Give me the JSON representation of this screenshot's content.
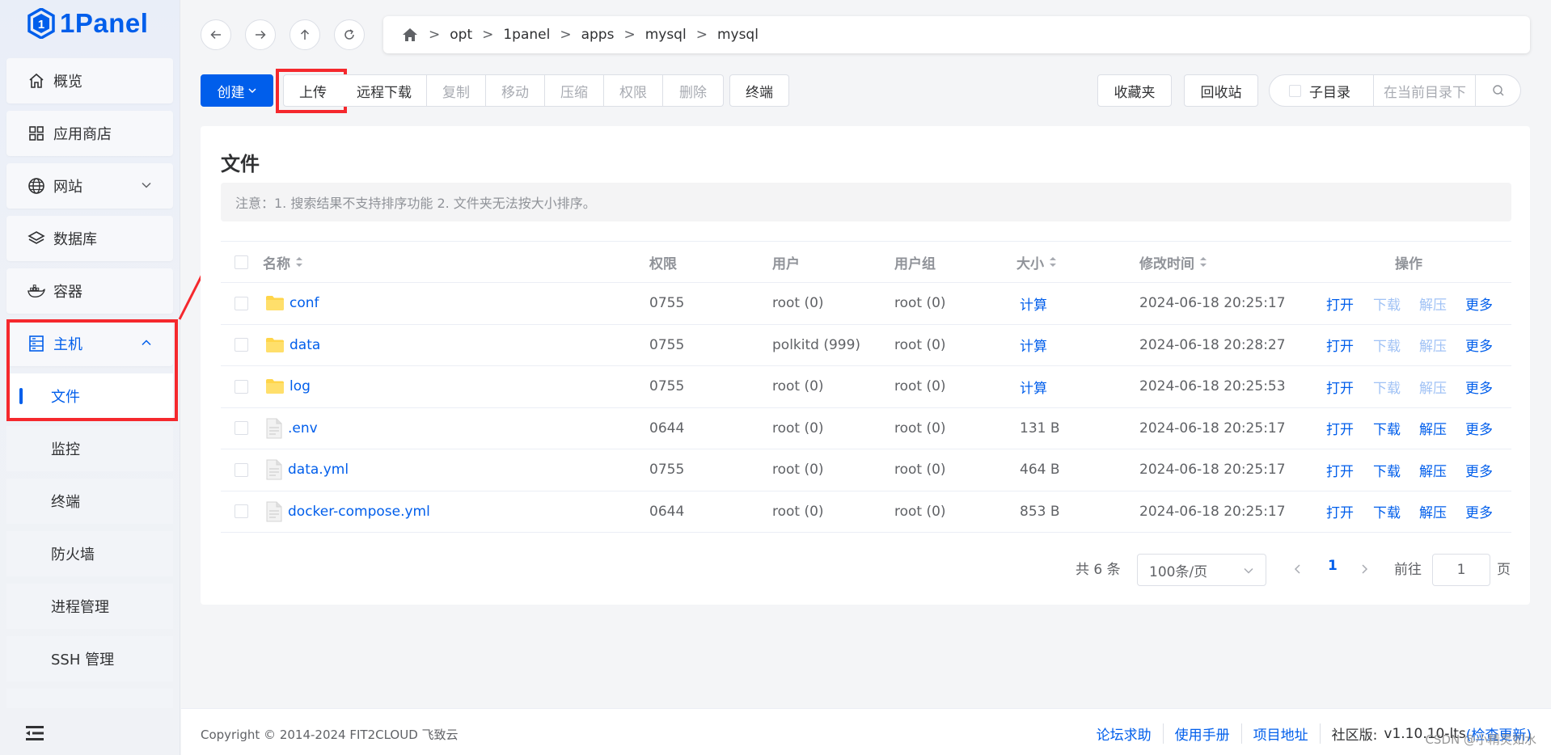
{
  "app": {
    "logo_text": "1Panel"
  },
  "sidebar": {
    "overview": "概览",
    "app_store": "应用商店",
    "website": "网站",
    "database": "数据库",
    "container": "容器",
    "host": "主机",
    "sub": {
      "files": "文件",
      "monitor": "监控",
      "terminal": "终端",
      "firewall": "防火墙",
      "process": "进程管理",
      "ssh": "SSH 管理"
    }
  },
  "breadcrumb": [
    "opt",
    "1panel",
    "apps",
    "mysql",
    "mysql"
  ],
  "toolbar": {
    "create": "创建",
    "upload": "上传",
    "remote_download": "远程下载",
    "copy": "复制",
    "move": "移动",
    "compress": "压缩",
    "permission": "权限",
    "delete": "删除",
    "terminal": "终端",
    "favorites": "收藏夹",
    "recycle_bin": "回收站",
    "subdir": "子目录",
    "search_placeholder": "在当前目录下"
  },
  "card": {
    "title": "文件",
    "notice": "注意：1. 搜索结果不支持排序功能 2. 文件夹无法按大小排序。"
  },
  "table": {
    "headers": {
      "name": "名称",
      "perm": "权限",
      "user": "用户",
      "group": "用户组",
      "size": "大小",
      "mtime": "修改时间",
      "actions": "操作"
    },
    "actions": {
      "open": "打开",
      "download": "下载",
      "extract": "解压",
      "more": "更多"
    },
    "rows": [
      {
        "name": "conf",
        "type": "folder",
        "perm": "0755",
        "user": "root (0)",
        "group": "root (0)",
        "size": "计算",
        "mtime": "2024-06-18 20:25:17"
      },
      {
        "name": "data",
        "type": "folder",
        "perm": "0755",
        "user": "polkitd (999)",
        "group": "root (0)",
        "size": "计算",
        "mtime": "2024-06-18 20:28:27"
      },
      {
        "name": "log",
        "type": "folder",
        "perm": "0755",
        "user": "root (0)",
        "group": "root (0)",
        "size": "计算",
        "mtime": "2024-06-18 20:25:53"
      },
      {
        "name": ".env",
        "type": "file",
        "perm": "0644",
        "user": "root (0)",
        "group": "root (0)",
        "size": "131 B",
        "mtime": "2024-06-18 20:25:17"
      },
      {
        "name": "data.yml",
        "type": "file",
        "perm": "0755",
        "user": "root (0)",
        "group": "root (0)",
        "size": "464 B",
        "mtime": "2024-06-18 20:25:17"
      },
      {
        "name": "docker-compose.yml",
        "type": "file",
        "perm": "0644",
        "user": "root (0)",
        "group": "root (0)",
        "size": "853 B",
        "mtime": "2024-06-18 20:25:17"
      }
    ]
  },
  "pagination": {
    "total": "共 6 条",
    "page_size": "100条/页",
    "current": "1",
    "goto_label": "前往",
    "goto_value": "1",
    "page_suffix": "页"
  },
  "footer": {
    "copyright": "Copyright © 2014-2024 FIT2CLOUD 飞致云",
    "forum": "论坛求助",
    "manual": "使用手册",
    "project": "项目地址",
    "edition_label": "社区版:",
    "version": "v1.10.10-lts",
    "check_update": "(检查更新)",
    "watermark": "CSDN @小精灵如水"
  },
  "colors": {
    "accent": "#005eeb",
    "highlight_box": "#f5282d",
    "folder": "#ffd54a"
  }
}
